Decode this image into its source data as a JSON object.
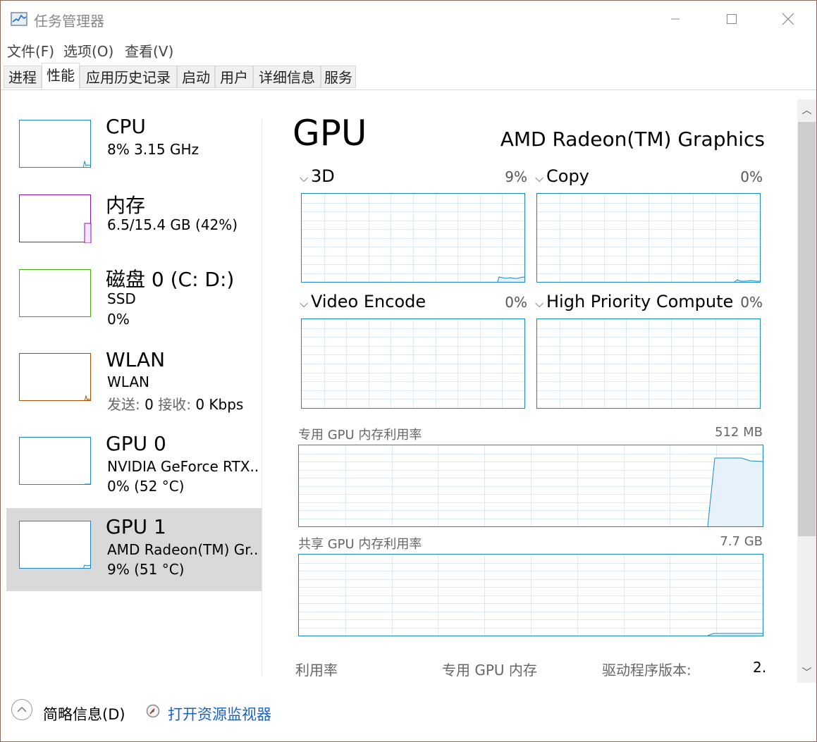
{
  "window": {
    "title": "任务管理器"
  },
  "menu": [
    "文件(F)",
    "选项(O)",
    "查看(V)"
  ],
  "tabs": [
    "进程",
    "性能",
    "应用历史记录",
    "启动",
    "用户",
    "详细信息",
    "服务"
  ],
  "active_tab": "性能",
  "devices": [
    {
      "title": "CPU",
      "line1": "8%  3.15 GHz",
      "line2": "",
      "color": "#1a86c1",
      "icon": "cpu-graph"
    },
    {
      "title": "内存",
      "line1": "6.5/15.4 GB (42%)",
      "line2": "",
      "color": "#8b12ae",
      "icon": "memory-graph"
    },
    {
      "title": "磁盘 0 (C: D:)",
      "line1": "SSD",
      "line2": "0%",
      "color": "#4da60c",
      "icon": "disk-graph"
    },
    {
      "title": "WLAN",
      "line1": "WLAN",
      "line2_send_label": "发送:",
      "line2_send_val": "0",
      "line2_recv_label": "接收:",
      "line2_recv_val": "0 Kbps",
      "color": "#a74f01",
      "icon": "network-graph"
    },
    {
      "title": "GPU 0",
      "line1": "NVIDIA GeForce RTX..",
      "line2": "0%  (52 °C)",
      "color": "#1a86c1",
      "icon": "gpu-graph"
    },
    {
      "title": "GPU 1",
      "line1": "AMD Radeon(TM) Gr..",
      "line2": "9%  (51 °C)",
      "color": "#1a86c1",
      "icon": "gpu-graph",
      "selected": true
    }
  ],
  "main": {
    "title": "GPU",
    "subtitle": "AMD Radeon(TM) Graphics",
    "engines": [
      {
        "name": "3D",
        "percent": "9%"
      },
      {
        "name": "Copy",
        "percent": "0%"
      },
      {
        "name": "Video Encode",
        "percent": "0%"
      },
      {
        "name": "High Priority Compute",
        "percent": "0%"
      }
    ],
    "dedicated_label": "专用 GPU 内存利用率",
    "dedicated_value": "512 MB",
    "shared_label": "共享 GPU 内存利用率",
    "shared_value": "7.7 GB",
    "stats": {
      "utilization": "利用率",
      "dedicated_mem": "专用 GPU 内存",
      "driver_version": "驱动程序版本:",
      "driver_value": "2."
    }
  },
  "bottom": {
    "fewer_details": "简略信息(D)",
    "open_resmon": "打开资源监视器"
  },
  "colors": {
    "accent": "#1a86c1",
    "link": "#1862c5",
    "selected_bg": "#d9d9d9"
  }
}
